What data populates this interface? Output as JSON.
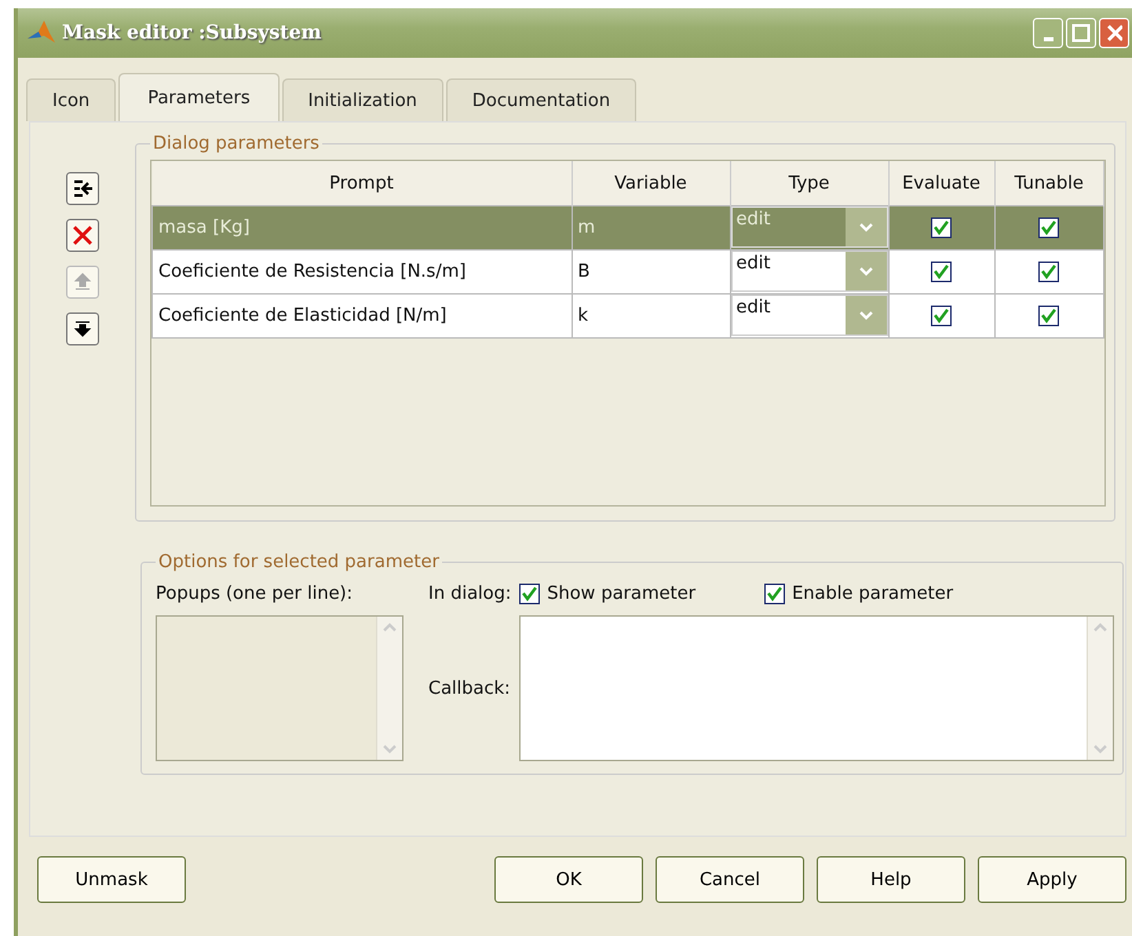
{
  "window": {
    "title": "Mask editor :Subsystem"
  },
  "tabs": [
    {
      "label": "Icon",
      "selected": false
    },
    {
      "label": "Parameters",
      "selected": true
    },
    {
      "label": "Initialization",
      "selected": false
    },
    {
      "label": "Documentation",
      "selected": false
    }
  ],
  "side_buttons": [
    {
      "kind": "add",
      "disabled": false
    },
    {
      "kind": "delete",
      "disabled": false
    },
    {
      "kind": "up",
      "disabled": true
    },
    {
      "kind": "down",
      "disabled": false
    }
  ],
  "dialog_parameters": {
    "title": "Dialog parameters",
    "columns": [
      "Prompt",
      "Variable",
      "Type",
      "Evaluate",
      "Tunable"
    ],
    "rows": [
      {
        "prompt": "masa [Kg]",
        "variable": "m",
        "type": "edit",
        "evaluate": true,
        "tunable": true,
        "selected": true
      },
      {
        "prompt": "Coeficiente de Resistencia [N.s/m]",
        "variable": "B",
        "type": "edit",
        "evaluate": true,
        "tunable": true,
        "selected": false
      },
      {
        "prompt": "Coeficiente de Elasticidad [N/m]",
        "variable": "k",
        "type": "edit",
        "evaluate": true,
        "tunable": true,
        "selected": false
      }
    ]
  },
  "options": {
    "title": "Options for selected parameter",
    "popups_label": "Popups (one per line):",
    "in_dialog_label": "In dialog:",
    "show_parameter": {
      "label": "Show parameter",
      "checked": true
    },
    "enable_parameter": {
      "label": "Enable parameter",
      "checked": true
    },
    "callback_label": "Callback:"
  },
  "buttons": {
    "left": [
      "Unmask"
    ],
    "right": [
      "OK",
      "Cancel",
      "Help",
      "Apply"
    ]
  }
}
